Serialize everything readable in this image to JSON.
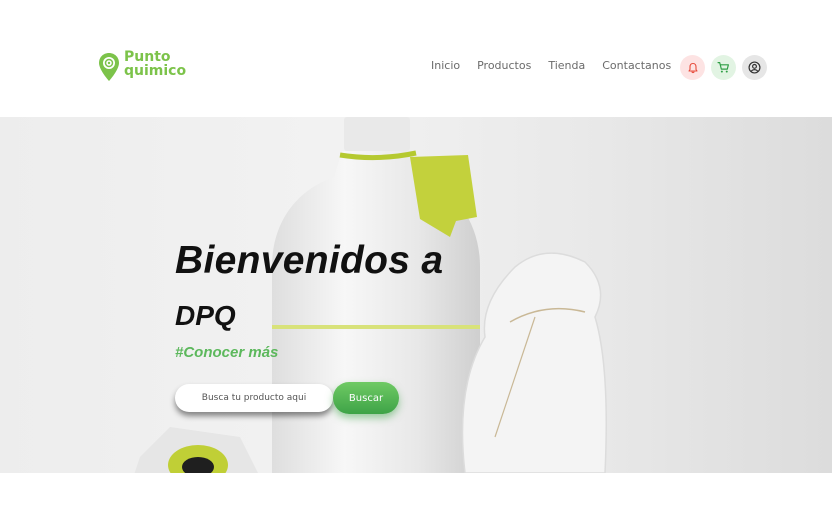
{
  "brand": {
    "line1": "Punto",
    "line2": "quimico",
    "color": "#7cc34a"
  },
  "nav": {
    "items": [
      {
        "label": "Inicio"
      },
      {
        "label": "Productos"
      },
      {
        "label": "Tienda"
      },
      {
        "label": "Contactanos"
      }
    ]
  },
  "header_icons": [
    {
      "name": "bell-icon",
      "color": "#e74c3c"
    },
    {
      "name": "cart-icon",
      "color": "#2e9e44"
    },
    {
      "name": "user-circle-icon",
      "color": "#333333"
    }
  ],
  "hero": {
    "title": "Bienvenidos a",
    "subtitle": "DPQ",
    "link": "#Conocer más",
    "search": {
      "placeholder": "Busca tu producto aqui",
      "button_label": "Buscar"
    },
    "accent": "#5cb85c"
  }
}
